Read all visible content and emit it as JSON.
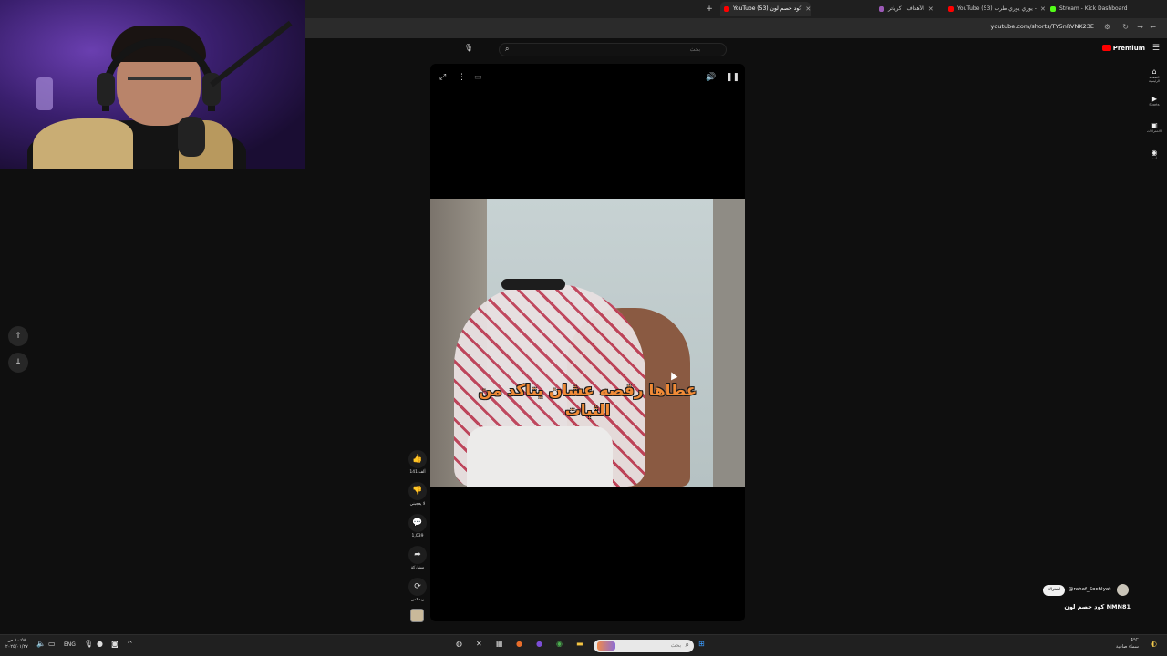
{
  "browser": {
    "tabs": [
      {
        "label": "Stream - Kick Dashboard",
        "favicon_color": "#53fc18",
        "active": false
      },
      {
        "label": "YouTube (53) يوري يوري طرب -",
        "favicon_color": "#ff0000",
        "active": false
      },
      {
        "label": "الأهداف | كرياتر",
        "favicon_color": "#9b59b6",
        "active": false
      },
      {
        "label": "YouTube (53) كود خصم لون",
        "favicon_color": "#ff0000",
        "active": true
      }
    ],
    "new_tab_label": "+",
    "url": "youtube.com/shorts/TY5nRVNK23E"
  },
  "youtube": {
    "search_placeholder": "بحث",
    "premium_label": "Premium",
    "nav": [
      {
        "icon": "⌂",
        "label": "الصفحة الرئيسية"
      },
      {
        "icon": "▶",
        "label": "Shorts"
      },
      {
        "icon": "▣",
        "label": "الاشتراكات"
      },
      {
        "icon": "◉",
        "label": "أنت"
      }
    ]
  },
  "short": {
    "caption": "عطاها رقصه عشان يتاكد من الثبات",
    "actions": [
      {
        "icon": "👍",
        "label": "141 ألف"
      },
      {
        "icon": "👎",
        "label": "لا يعجبني"
      },
      {
        "icon": "💬",
        "label": "1,039"
      },
      {
        "icon": "➦",
        "label": "مشاركة"
      },
      {
        "icon": "⟳",
        "label": "ريمكس"
      }
    ],
    "channel_handle": "@rahaf_Sochlyat",
    "subscribe_label": "اشتراك",
    "title": "كود خصم لون NMN81"
  },
  "taskbar": {
    "time": "١٠:٥٨ ص",
    "date": "٢٠٢٥/٠١/٢٧",
    "language": "ENG",
    "weather_temp": "4°C",
    "weather_desc": "سماء صافية",
    "search_placeholder": "بحث"
  },
  "colors": {
    "brand": "#ff0000",
    "accent": "#53fc18"
  }
}
